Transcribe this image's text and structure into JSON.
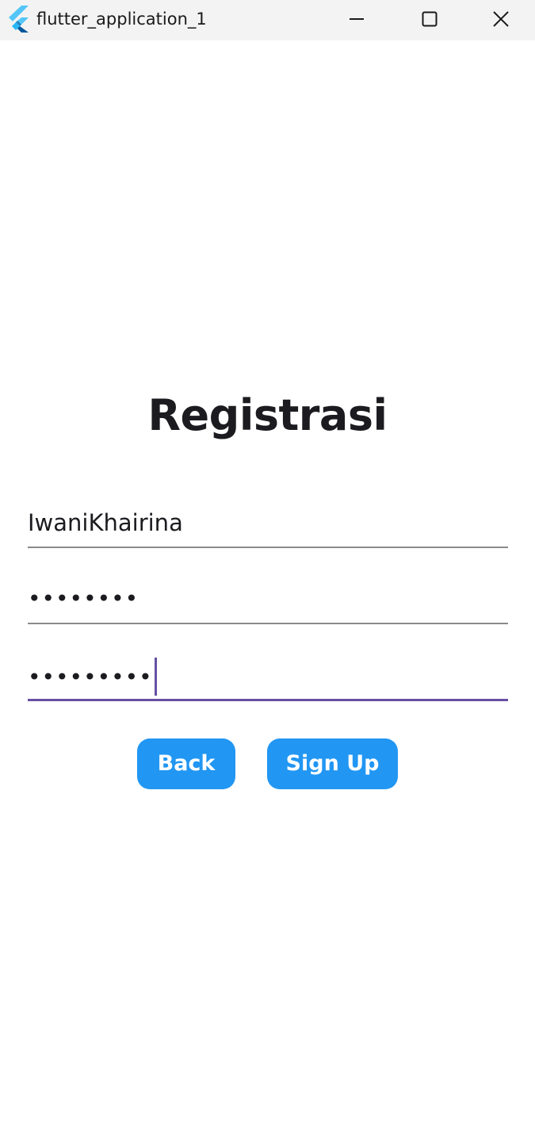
{
  "window": {
    "title": "flutter_application_1",
    "icon": "flutter-logo-icon",
    "controls": [
      "minimize-icon",
      "maximize-icon",
      "close-icon"
    ]
  },
  "form": {
    "title": "Registrasi",
    "username": {
      "value": "IwaniKhairina"
    },
    "password": {
      "mask": "••••••••"
    },
    "confirm_password": {
      "mask": "•••••••••"
    }
  },
  "buttons": {
    "back_label": "Back",
    "signup_label": "Sign Up"
  },
  "colors": {
    "button_bg": "#2196f3",
    "focus_underline": "#6750a4",
    "underline": "#8a8a8a",
    "titlebar_bg": "#f3f3f3"
  }
}
